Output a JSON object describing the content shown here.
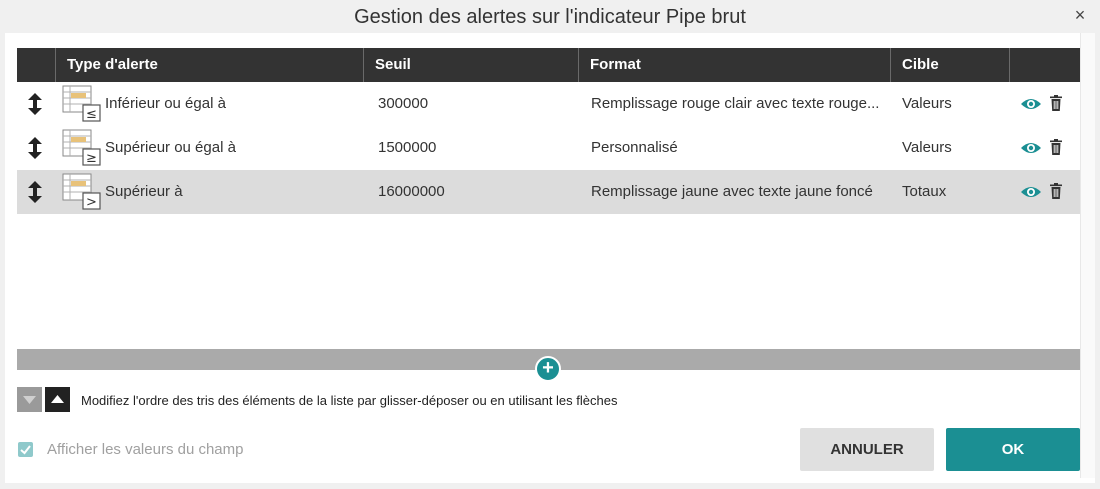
{
  "dialog": {
    "title": "Gestion des alertes sur l'indicateur Pipe brut",
    "close_symbol": "×"
  },
  "grid": {
    "columns": [
      "",
      "Type d'alerte",
      "Seuil",
      "Format",
      "Cible",
      ""
    ],
    "rows": [
      {
        "type": "Inférieur ou égal à",
        "icon": "less-or-equal-grid-icon",
        "icon_symbol": "≤",
        "threshold": "300000",
        "format": "Remplissage rouge clair avec texte rouge...",
        "target": "Valeurs",
        "selected": false
      },
      {
        "type": "Supérieur ou égal à",
        "icon": "greater-or-equal-grid-icon",
        "icon_symbol": "≥",
        "threshold": "1500000",
        "format": "Personnalisé",
        "target": "Valeurs",
        "selected": false
      },
      {
        "type": "Supérieur à",
        "icon": "greater-than-grid-icon",
        "icon_symbol": ">",
        "threshold": "16000000",
        "format": "Remplissage jaune avec texte jaune foncé",
        "target": "Totaux",
        "selected": true
      }
    ]
  },
  "add_button": {
    "symbol": "+"
  },
  "sort_hint": "Modifiez l'ordre des tris des éléments de la liste par glisser-déposer ou en utilisant les flèches",
  "show_values": {
    "label": "Afficher les valeurs du champ",
    "checked": true
  },
  "buttons": {
    "cancel": "ANNULER",
    "ok": "OK"
  },
  "colors": {
    "accent": "#1b8f93",
    "header": "#333333",
    "selected_row": "#dcdcdc"
  }
}
